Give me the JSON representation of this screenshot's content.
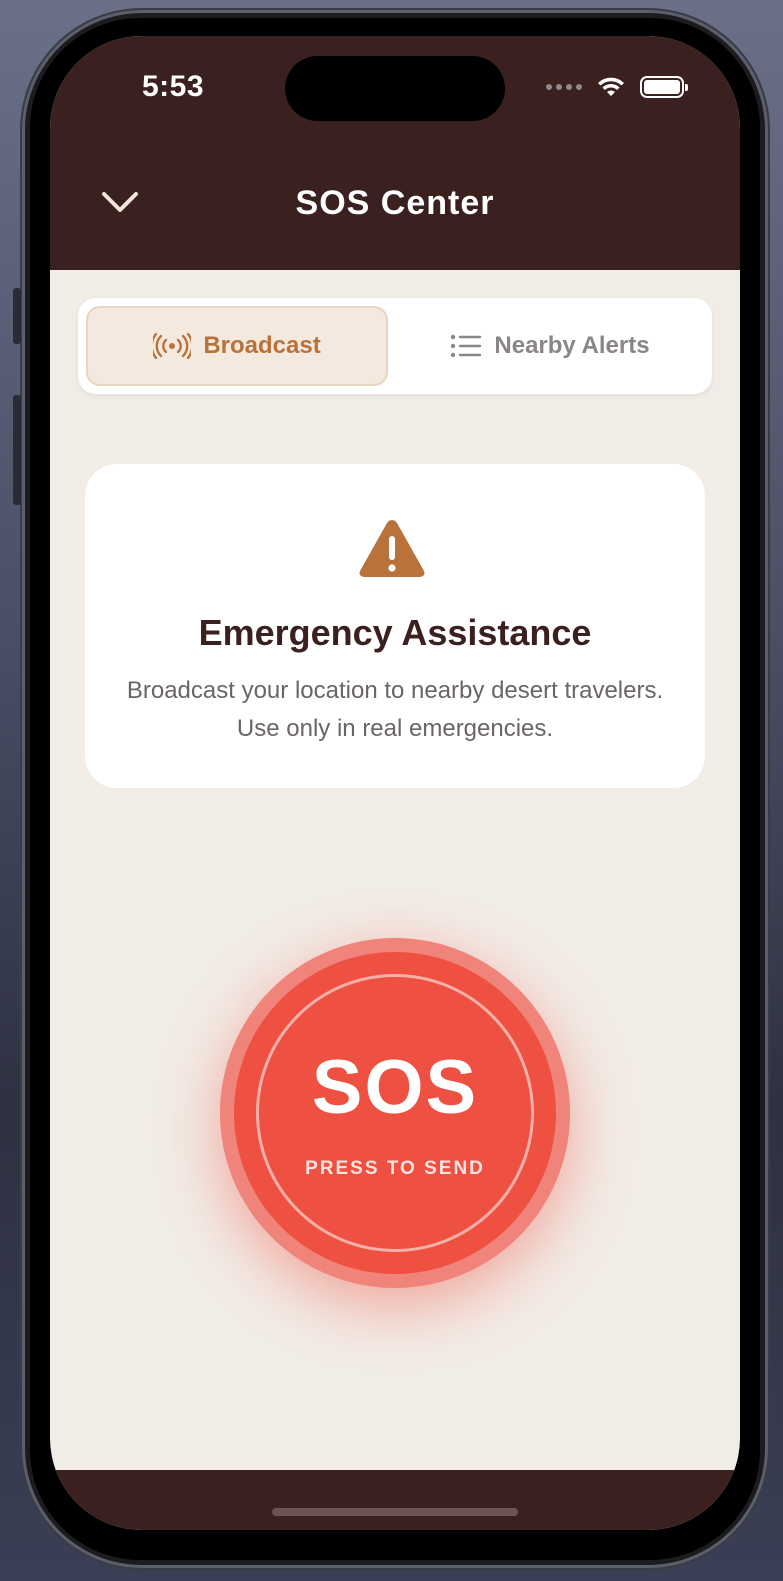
{
  "status_bar": {
    "time": "5:53"
  },
  "header": {
    "title": "SOS Center",
    "back_icon": "chevron-down-icon"
  },
  "tabs": [
    {
      "label": "Broadcast",
      "icon": "broadcast-icon",
      "active": true
    },
    {
      "label": "Nearby Alerts",
      "icon": "list-icon",
      "active": false
    }
  ],
  "info_card": {
    "icon": "warning-icon",
    "title": "Emergency Assistance",
    "body": "Broadcast your location to nearby desert travelers. Use only in real emergencies."
  },
  "sos_button": {
    "label": "SOS",
    "sublabel": "PRESS TO SEND"
  },
  "colors": {
    "header_bg": "#3a201e",
    "accent": "#b9733a",
    "sos_red": "#ee5141",
    "background": "#f2ece6"
  }
}
